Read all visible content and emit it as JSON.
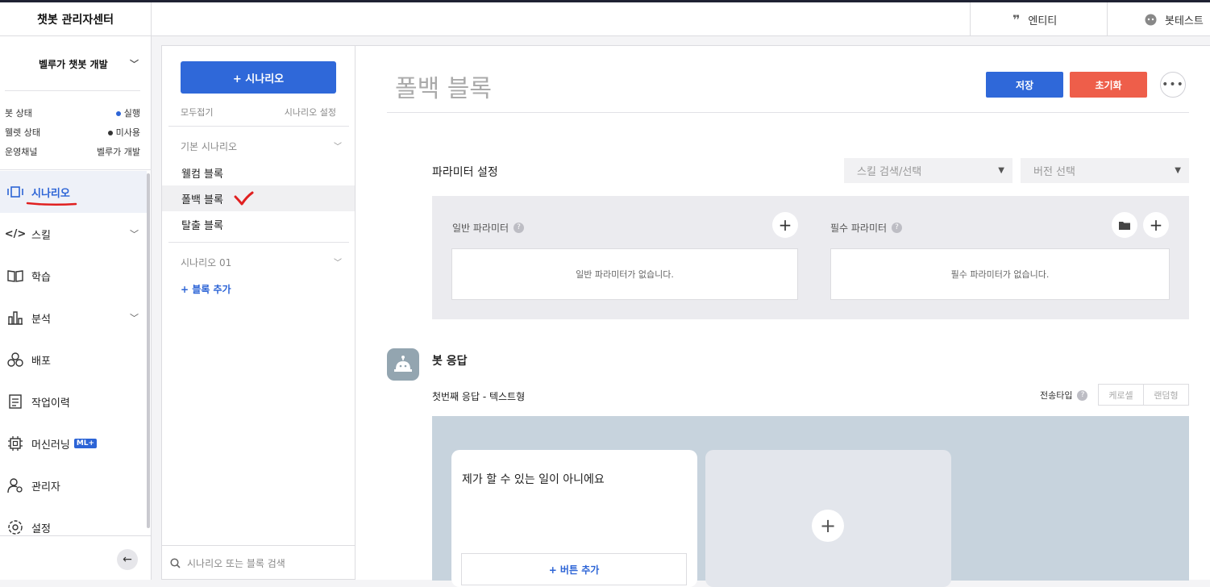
{
  "brand": "챗봇 관리자센터",
  "topbar": {
    "entity_label": "엔티티",
    "bottest_label": "봇테스트"
  },
  "nav": {
    "bot_name": "벨루가 챗봇 개발",
    "status": [
      {
        "label": "봇 상태",
        "value": "실행",
        "color": "#2c64d6"
      },
      {
        "label": "웰렛 상태",
        "value": "미사용",
        "color": "#333333"
      },
      {
        "label": "운영채널",
        "value": "벨루가 개발",
        "color": ""
      }
    ],
    "items": [
      {
        "label": "시나리오",
        "icon": "scenario-icon",
        "active": true
      },
      {
        "label": "스킬",
        "icon": "code-icon",
        "expandable": true
      },
      {
        "label": "학습",
        "icon": "book-icon"
      },
      {
        "label": "분석",
        "icon": "bar-chart-icon",
        "expandable": true
      },
      {
        "label": "배포",
        "icon": "deploy-icon"
      },
      {
        "label": "작업이력",
        "icon": "history-icon"
      },
      {
        "label": "머신러닝",
        "icon": "chip-icon",
        "badge": "ML+"
      },
      {
        "label": "관리자",
        "icon": "admin-icon"
      },
      {
        "label": "설정",
        "icon": "gear-icon"
      }
    ]
  },
  "scenario_panel": {
    "add_button": "+ 시나리오",
    "collapse_all": "모두접기",
    "settings": "시나리오 설정",
    "groups": [
      {
        "title": "기본 시나리오",
        "blocks": [
          "웰컴 블록",
          "폴백 블록",
          "탈출 블록"
        ]
      },
      {
        "title": "시나리오 01",
        "blocks": []
      }
    ],
    "add_block": "+ 블록 추가",
    "search_placeholder": "시나리오 또는 블록 검색"
  },
  "main": {
    "title": "폴백 블록",
    "save": "저장",
    "reset": "초기화",
    "save_color": "#2f68d9",
    "reset_color": "#ee5e4a",
    "param_section": "파라미터 설정",
    "skill_placeholder": "스킬 검색/선택",
    "version_placeholder": "버전 선택",
    "general_param": "일반 파라미터",
    "required_param": "필수 파라미터",
    "general_empty": "일반 파라미터가 없습니다.",
    "required_empty": "필수 파라미터가 없습니다.",
    "bot_response": "봇 응답",
    "first_response": "첫번째 응답 - 텍스트형",
    "send_type": "전송타입",
    "send_types": [
      "케로셀",
      "랜덤형"
    ],
    "card_text": "제가 할 수 있는 일이 아니에요",
    "add_button": "+ 버튼 추가"
  }
}
